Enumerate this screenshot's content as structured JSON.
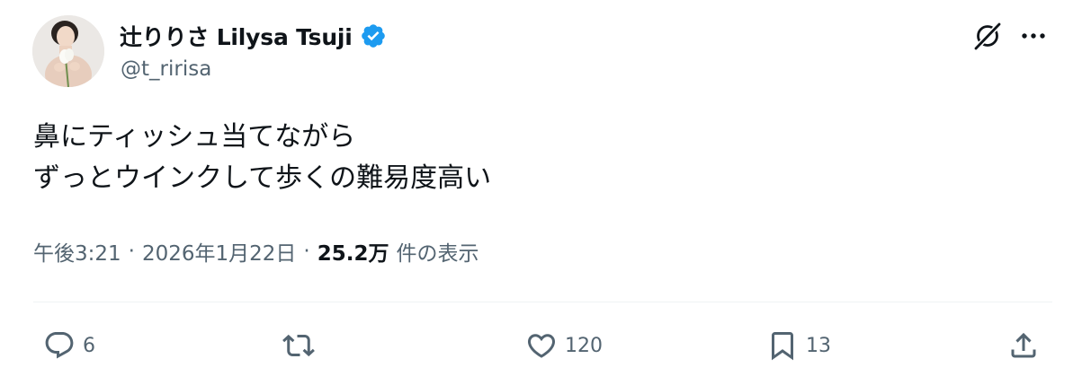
{
  "author": {
    "display_name": "辻りりさ Lilysa Tsuji",
    "handle": "@t_ririsa",
    "verified": true,
    "verified_color": "#1d9bf0"
  },
  "header_actions": {
    "grok_icon": "grok-icon",
    "more_icon": "more-icon"
  },
  "tweet": {
    "lines": [
      "鼻にティッシュ当てながら",
      "ずっとウインクして歩くの難易度高い"
    ]
  },
  "meta": {
    "time": "午後3:21",
    "separator": "·",
    "date": "2026年1月22日",
    "views_count": "25.2万",
    "views_label": "件の表示"
  },
  "actions": {
    "reply": {
      "icon": "reply-icon",
      "count": "6"
    },
    "retweet": {
      "icon": "retweet-icon",
      "count": ""
    },
    "like": {
      "icon": "heart-icon",
      "count": "120"
    },
    "bookmark": {
      "icon": "bookmark-icon",
      "count": "13"
    },
    "share": {
      "icon": "share-icon",
      "count": ""
    }
  },
  "colors": {
    "text_primary": "#0f1419",
    "text_secondary": "#536471",
    "divider": "#eff3f4",
    "accent": "#1d9bf0"
  }
}
